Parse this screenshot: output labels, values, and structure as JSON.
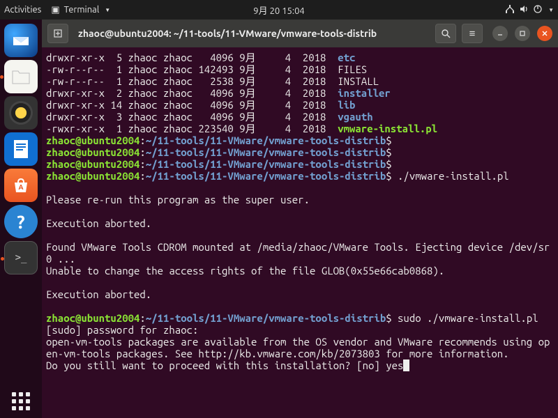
{
  "topbar": {
    "activities": "Activities",
    "app_label": "Terminal",
    "clock": "9月 20  15:04"
  },
  "window": {
    "title": "zhaoc@ubuntu2004: ~/11-tools/11-VMware/vmware-tools-distrib"
  },
  "ls": [
    {
      "perm": "drwxr-xr-x",
      "links": "5",
      "user": "zhaoc",
      "group": "zhaoc",
      "size": "4096",
      "mon": "9月",
      "day": "4",
      "year": "2018",
      "name": "etc",
      "cls": "c-b"
    },
    {
      "perm": "-rw-r--r--",
      "links": "1",
      "user": "zhaoc",
      "group": "zhaoc",
      "size": "142493",
      "mon": "9月",
      "day": "4",
      "year": "2018",
      "name": "FILES",
      "cls": ""
    },
    {
      "perm": "-rw-r--r--",
      "links": "1",
      "user": "zhaoc",
      "group": "zhaoc",
      "size": "2538",
      "mon": "9月",
      "day": "4",
      "year": "2018",
      "name": "INSTALL",
      "cls": ""
    },
    {
      "perm": "drwxr-xr-x",
      "links": "2",
      "user": "zhaoc",
      "group": "zhaoc",
      "size": "4096",
      "mon": "9月",
      "day": "4",
      "year": "2018",
      "name": "installer",
      "cls": "c-b"
    },
    {
      "perm": "drwxr-xr-x",
      "links": "14",
      "user": "zhaoc",
      "group": "zhaoc",
      "size": "4096",
      "mon": "9月",
      "day": "4",
      "year": "2018",
      "name": "lib",
      "cls": "c-b"
    },
    {
      "perm": "drwxr-xr-x",
      "links": "3",
      "user": "zhaoc",
      "group": "zhaoc",
      "size": "4096",
      "mon": "9月",
      "day": "4",
      "year": "2018",
      "name": "vgauth",
      "cls": "c-b"
    },
    {
      "perm": "-rwxr-xr-x",
      "links": "1",
      "user": "zhaoc",
      "group": "zhaoc",
      "size": "223540",
      "mon": "9月",
      "day": "4",
      "year": "2018",
      "name": "vmware-install.pl",
      "cls": "c-x"
    }
  ],
  "prompt": {
    "userhost": "zhaoc@ubuntu2004",
    "path": "~/11-tools/11-VMware/vmware-tools-distrib",
    "symbol": "$"
  },
  "lines": {
    "cmd1": "./vmware-install.pl",
    "msg_rerun": "Please re-run this program as the super user.",
    "msg_abort": "Execution aborted.",
    "msg_found": "Found VMware Tools CDROM mounted at /media/zhaoc/VMware Tools. Ejecting device /dev/sr0 ...",
    "msg_unable": "Unable to change the access rights of the file GLOB(0x55e66cab0868).",
    "cmd2": "sudo ./vmware-install.pl",
    "sudo_pw": "[sudo] password for zhaoc:",
    "openvm": "open-vm-tools packages are available from the OS vendor and VMware recommends using open-vm-tools packages. See http://kb.vmware.com/kb/2073803 for more information.",
    "proceed": "Do you still want to proceed with this installation? [no] ",
    "answer": "yes"
  }
}
